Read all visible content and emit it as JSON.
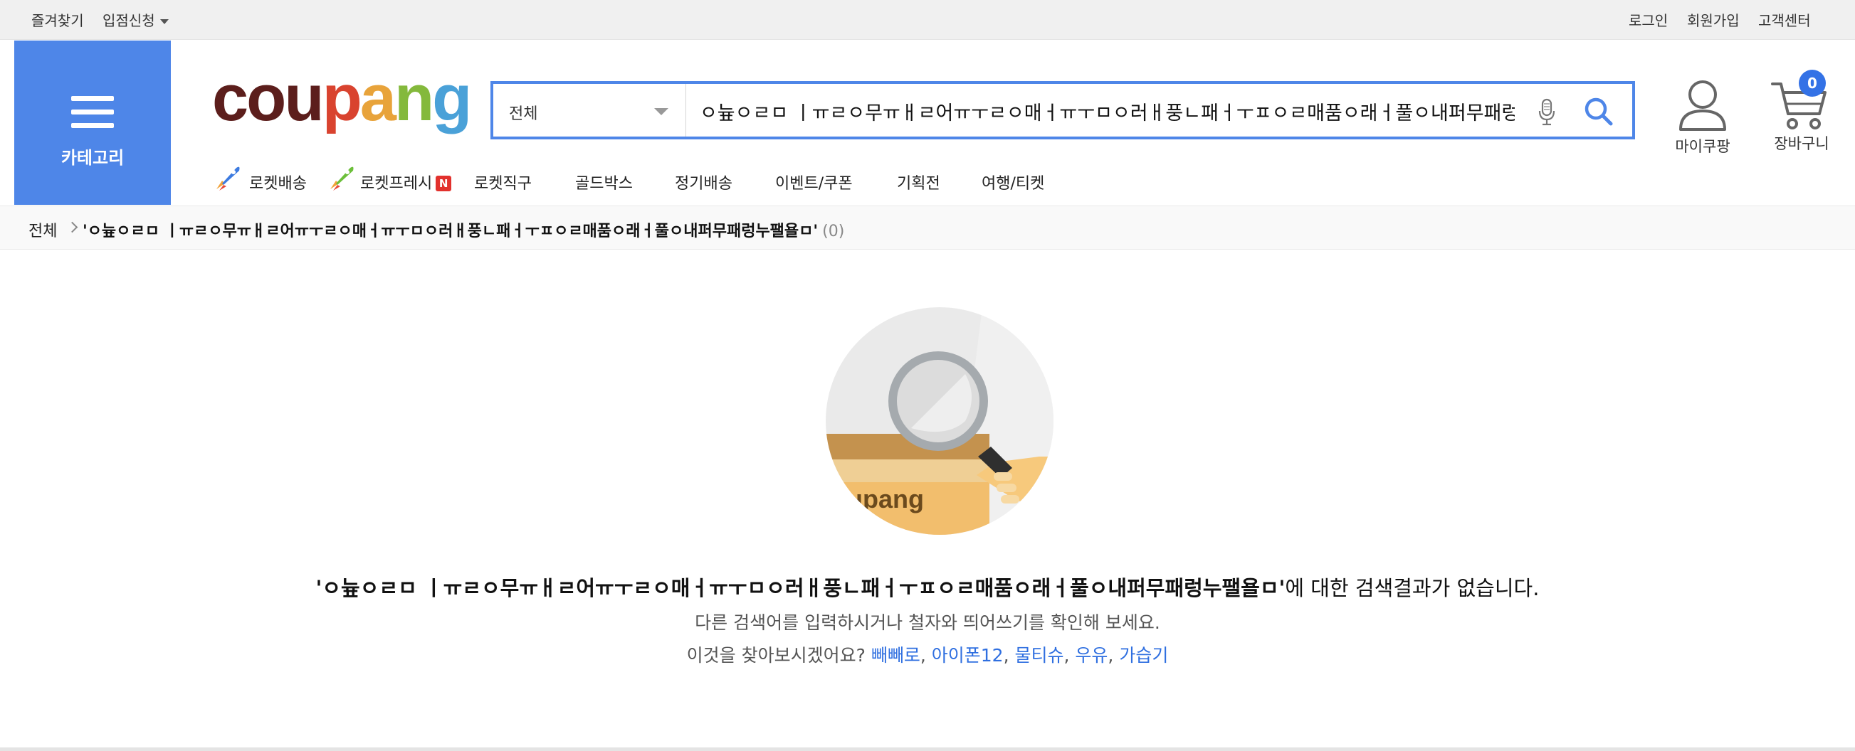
{
  "topbar": {
    "bookmark": "즐겨찾기",
    "seller_apply": "입점신청",
    "login": "로그인",
    "signup": "회원가입",
    "customer_center": "고객센터"
  },
  "header": {
    "category_label": "카테고리",
    "logo": {
      "c": "c",
      "o": "o",
      "u": "u",
      "p": "p",
      "a": "a",
      "n": "n",
      "g": "g"
    },
    "colors": {
      "blue": "#4e86e8",
      "badge": "#3472e6",
      "link": "#2f6fe0",
      "new_badge": "#e2312d"
    },
    "search": {
      "category": "전체",
      "query": "ㅇ늎ㅇㄹㅁ ㅣㅠㄹㅇ무ㅠㅐㄹ어ㅠㅜㄹㅇ매ㅓㅠㅜㅁㅇ러ㅐ풍ㄴ패ㅓㅜㅍㅇㄹ매품ㅇ래ㅓ풀ㅇ내퍼무패렁누팰"
    },
    "mycoupang": "마이쿠팡",
    "cart_label": "장바구니",
    "cart_count": "0"
  },
  "nav": {
    "rocket_delivery": "로켓배송",
    "rocket_fresh": "로켓프레시",
    "new_badge": "N",
    "rocket_direct": "로켓직구",
    "goldbox": "골드박스",
    "subscription": "정기배송",
    "event_coupon": "이벤트/쿠폰",
    "exhibition": "기획전",
    "travel_ticket": "여행/티켓"
  },
  "breadcrumb": {
    "home": "전체",
    "query": "'ㅇ늎ㅇㄹㅁ ㅣㅠㄹㅇ무ㅠㅐㄹ어ㅠㅜㄹㅇ매ㅓㅠㅜㅁㅇ러ㅐ풍ㄴ패ㅓㅜㅍㅇㄹ매품ㅇ래ㅓ풀ㅇ내퍼무패렁누팰욜ㅁ'",
    "count": "(0)"
  },
  "empty": {
    "illustration_text": "upang",
    "query_quoted": "'ㅇ늎ㅇㄹㅁ ㅣㅠㄹㅇ무ㅠㅐㄹ어ㅠㅜㄹㅇ매ㅓㅠㅜㅁㅇ러ㅐ풍ㄴ패ㅓㅜㅍㅇㄹ매품ㅇ래ㅓ풀ㅇ내퍼무패렁누팰욜ㅁ'",
    "no_result_suffix": "에 대한 검색결과가 없습니다.",
    "hint": "다른 검색어를 입력하시거나 철자와 띄어쓰기를 확인해 보세요.",
    "suggest_prefix": "이것을 찾아보시겠어요? ",
    "suggestions": [
      "빼빼로",
      "아이폰12",
      "물티슈",
      "우유",
      "가습기"
    ],
    "separator": ", "
  }
}
